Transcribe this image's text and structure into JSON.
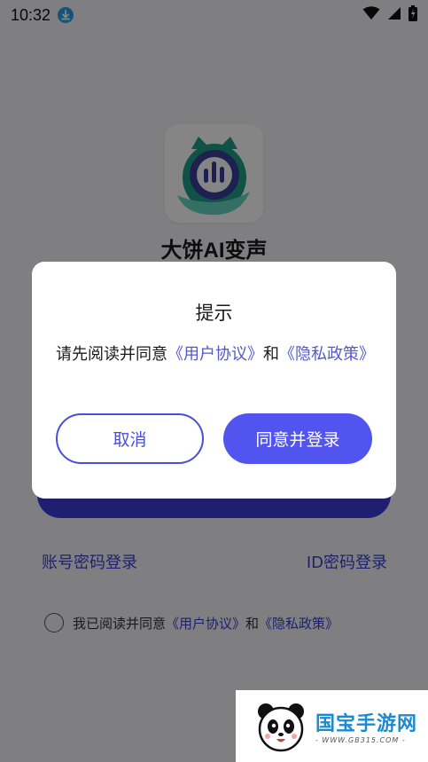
{
  "status_bar": {
    "time": "10:32",
    "icons": [
      "download-icon",
      "wifi-icon",
      "signal-icon",
      "battery-charging-icon"
    ]
  },
  "app": {
    "name": "大饼AI变声",
    "login_links": {
      "account_password": "账号密码登录",
      "id_password": "ID密码登录"
    },
    "agreement": {
      "prefix": "我已阅读并同意",
      "user_agreement": "《用户协议》",
      "and": "和",
      "privacy_policy": "《隐私政策》"
    }
  },
  "dialog": {
    "title": "提示",
    "message_prefix": "请先阅读并同意",
    "user_agreement": "《用户协议》",
    "and": "和",
    "privacy_policy": "《隐私政策》",
    "cancel_label": "取消",
    "agree_label": "同意并登录"
  },
  "watermark": {
    "title": "国宝手游网",
    "url": "- WWW.GB315.COM -"
  },
  "colors": {
    "accent": "#5254f0",
    "link": "#3b3fcf",
    "overlay": "rgba(0,0,0,0.48)"
  }
}
